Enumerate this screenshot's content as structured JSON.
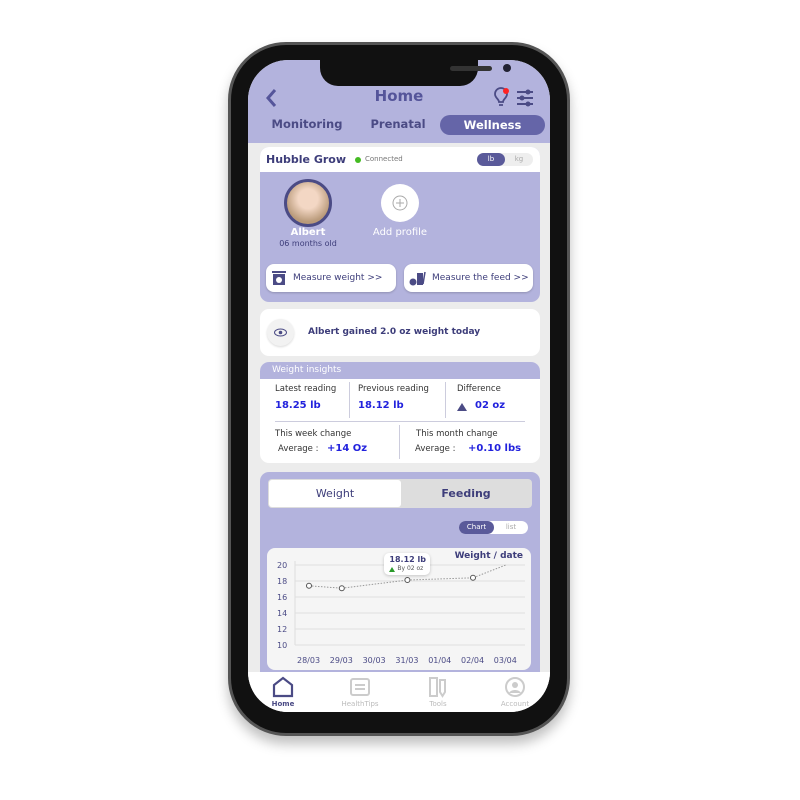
{
  "header": {
    "title": "Home",
    "back_icon": "chevron-left-icon",
    "tips_icon": "lightbulb-icon",
    "settings_icon": "sliders-icon",
    "notification_color": "#ff2222"
  },
  "tabs": [
    {
      "label": "Monitoring"
    },
    {
      "label": "Prenatal"
    },
    {
      "label": "Wellness",
      "active": true
    }
  ],
  "device": {
    "name": "Hubble Grow",
    "status": "Connected",
    "status_color": "#44bb22",
    "units": [
      "lb",
      "kg"
    ],
    "selected_unit": "lb"
  },
  "profiles": [
    {
      "name": "Albert",
      "age": "06 months old"
    },
    {
      "name": "Add profile"
    }
  ],
  "actions": [
    {
      "label": "Measure weight >>",
      "icon": "scale-icon"
    },
    {
      "label": "Measure the feed >>",
      "icon": "bottle-icon"
    }
  ],
  "notice": {
    "text": "Albert gained 2.0 oz weight today",
    "icon": "eye-icon"
  },
  "insights": {
    "title": "Weight insights",
    "latest_label": "Latest reading",
    "latest": "18.25 lb",
    "previous_label": "Previous reading",
    "previous": "18.12 lb",
    "difference_label": "Difference",
    "difference": "02 oz",
    "week_label": "This week change",
    "week_avg_label": "Average :",
    "week_avg": "+14 Oz",
    "month_label": "This month change",
    "month_avg_label": "Average :",
    "month_avg": "+0.10 lbs"
  },
  "chart_tabs": [
    "Weight",
    "Feeding"
  ],
  "view_toggle": [
    "Chart",
    "list"
  ],
  "chart_data": {
    "type": "line",
    "title": "Weight / date",
    "categories": [
      "28/03",
      "29/03",
      "30/03",
      "31/03",
      "01/04",
      "02/04",
      "03/04"
    ],
    "points": [
      {
        "x": "28/03",
        "y": 17.4
      },
      {
        "x": "29/03",
        "y": 17.1
      },
      {
        "x": "31/03",
        "y": 18.12
      },
      {
        "x": "02/04",
        "y": 18.4
      },
      {
        "x": "03/04",
        "y": 20,
        "marker": false
      }
    ],
    "yticks": [
      20,
      18,
      16,
      14,
      12,
      10
    ],
    "ylim": [
      10,
      20
    ],
    "grid": true,
    "tooltip": {
      "value": "18.12 lb",
      "change": "By 02 oz",
      "at": "31/03"
    }
  },
  "nav": [
    {
      "label": "Home",
      "icon": "home-icon",
      "active": true
    },
    {
      "label": "HealthTips",
      "icon": "news-icon"
    },
    {
      "label": "Tools",
      "icon": "tools-icon"
    },
    {
      "label": "Account",
      "icon": "account-icon"
    }
  ]
}
